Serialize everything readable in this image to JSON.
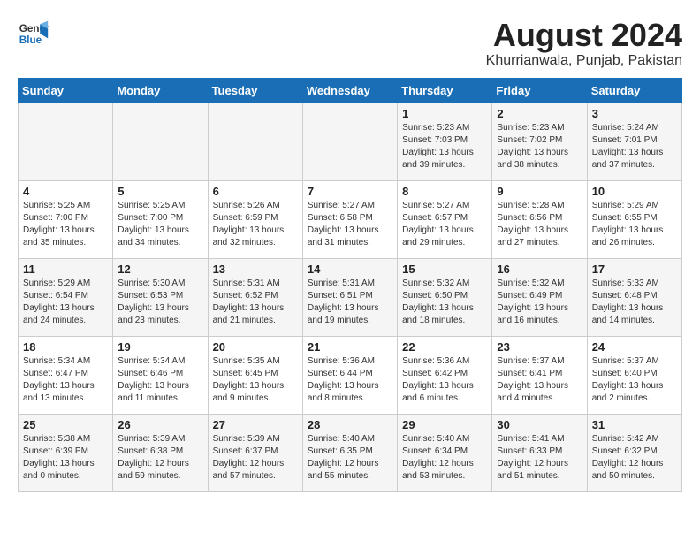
{
  "header": {
    "logo_line1": "General",
    "logo_line2": "Blue",
    "month_year": "August 2024",
    "location": "Khurrianwala, Punjab, Pakistan"
  },
  "days_of_week": [
    "Sunday",
    "Monday",
    "Tuesday",
    "Wednesday",
    "Thursday",
    "Friday",
    "Saturday"
  ],
  "weeks": [
    [
      {
        "day": "",
        "info": ""
      },
      {
        "day": "",
        "info": ""
      },
      {
        "day": "",
        "info": ""
      },
      {
        "day": "",
        "info": ""
      },
      {
        "day": "1",
        "info": "Sunrise: 5:23 AM\nSunset: 7:03 PM\nDaylight: 13 hours\nand 39 minutes."
      },
      {
        "day": "2",
        "info": "Sunrise: 5:23 AM\nSunset: 7:02 PM\nDaylight: 13 hours\nand 38 minutes."
      },
      {
        "day": "3",
        "info": "Sunrise: 5:24 AM\nSunset: 7:01 PM\nDaylight: 13 hours\nand 37 minutes."
      }
    ],
    [
      {
        "day": "4",
        "info": "Sunrise: 5:25 AM\nSunset: 7:00 PM\nDaylight: 13 hours\nand 35 minutes."
      },
      {
        "day": "5",
        "info": "Sunrise: 5:25 AM\nSunset: 7:00 PM\nDaylight: 13 hours\nand 34 minutes."
      },
      {
        "day": "6",
        "info": "Sunrise: 5:26 AM\nSunset: 6:59 PM\nDaylight: 13 hours\nand 32 minutes."
      },
      {
        "day": "7",
        "info": "Sunrise: 5:27 AM\nSunset: 6:58 PM\nDaylight: 13 hours\nand 31 minutes."
      },
      {
        "day": "8",
        "info": "Sunrise: 5:27 AM\nSunset: 6:57 PM\nDaylight: 13 hours\nand 29 minutes."
      },
      {
        "day": "9",
        "info": "Sunrise: 5:28 AM\nSunset: 6:56 PM\nDaylight: 13 hours\nand 27 minutes."
      },
      {
        "day": "10",
        "info": "Sunrise: 5:29 AM\nSunset: 6:55 PM\nDaylight: 13 hours\nand 26 minutes."
      }
    ],
    [
      {
        "day": "11",
        "info": "Sunrise: 5:29 AM\nSunset: 6:54 PM\nDaylight: 13 hours\nand 24 minutes."
      },
      {
        "day": "12",
        "info": "Sunrise: 5:30 AM\nSunset: 6:53 PM\nDaylight: 13 hours\nand 23 minutes."
      },
      {
        "day": "13",
        "info": "Sunrise: 5:31 AM\nSunset: 6:52 PM\nDaylight: 13 hours\nand 21 minutes."
      },
      {
        "day": "14",
        "info": "Sunrise: 5:31 AM\nSunset: 6:51 PM\nDaylight: 13 hours\nand 19 minutes."
      },
      {
        "day": "15",
        "info": "Sunrise: 5:32 AM\nSunset: 6:50 PM\nDaylight: 13 hours\nand 18 minutes."
      },
      {
        "day": "16",
        "info": "Sunrise: 5:32 AM\nSunset: 6:49 PM\nDaylight: 13 hours\nand 16 minutes."
      },
      {
        "day": "17",
        "info": "Sunrise: 5:33 AM\nSunset: 6:48 PM\nDaylight: 13 hours\nand 14 minutes."
      }
    ],
    [
      {
        "day": "18",
        "info": "Sunrise: 5:34 AM\nSunset: 6:47 PM\nDaylight: 13 hours\nand 13 minutes."
      },
      {
        "day": "19",
        "info": "Sunrise: 5:34 AM\nSunset: 6:46 PM\nDaylight: 13 hours\nand 11 minutes."
      },
      {
        "day": "20",
        "info": "Sunrise: 5:35 AM\nSunset: 6:45 PM\nDaylight: 13 hours\nand 9 minutes."
      },
      {
        "day": "21",
        "info": "Sunrise: 5:36 AM\nSunset: 6:44 PM\nDaylight: 13 hours\nand 8 minutes."
      },
      {
        "day": "22",
        "info": "Sunrise: 5:36 AM\nSunset: 6:42 PM\nDaylight: 13 hours\nand 6 minutes."
      },
      {
        "day": "23",
        "info": "Sunrise: 5:37 AM\nSunset: 6:41 PM\nDaylight: 13 hours\nand 4 minutes."
      },
      {
        "day": "24",
        "info": "Sunrise: 5:37 AM\nSunset: 6:40 PM\nDaylight: 13 hours\nand 2 minutes."
      }
    ],
    [
      {
        "day": "25",
        "info": "Sunrise: 5:38 AM\nSunset: 6:39 PM\nDaylight: 13 hours\nand 0 minutes."
      },
      {
        "day": "26",
        "info": "Sunrise: 5:39 AM\nSunset: 6:38 PM\nDaylight: 12 hours\nand 59 minutes."
      },
      {
        "day": "27",
        "info": "Sunrise: 5:39 AM\nSunset: 6:37 PM\nDaylight: 12 hours\nand 57 minutes."
      },
      {
        "day": "28",
        "info": "Sunrise: 5:40 AM\nSunset: 6:35 PM\nDaylight: 12 hours\nand 55 minutes."
      },
      {
        "day": "29",
        "info": "Sunrise: 5:40 AM\nSunset: 6:34 PM\nDaylight: 12 hours\nand 53 minutes."
      },
      {
        "day": "30",
        "info": "Sunrise: 5:41 AM\nSunset: 6:33 PM\nDaylight: 12 hours\nand 51 minutes."
      },
      {
        "day": "31",
        "info": "Sunrise: 5:42 AM\nSunset: 6:32 PM\nDaylight: 12 hours\nand 50 minutes."
      }
    ]
  ]
}
